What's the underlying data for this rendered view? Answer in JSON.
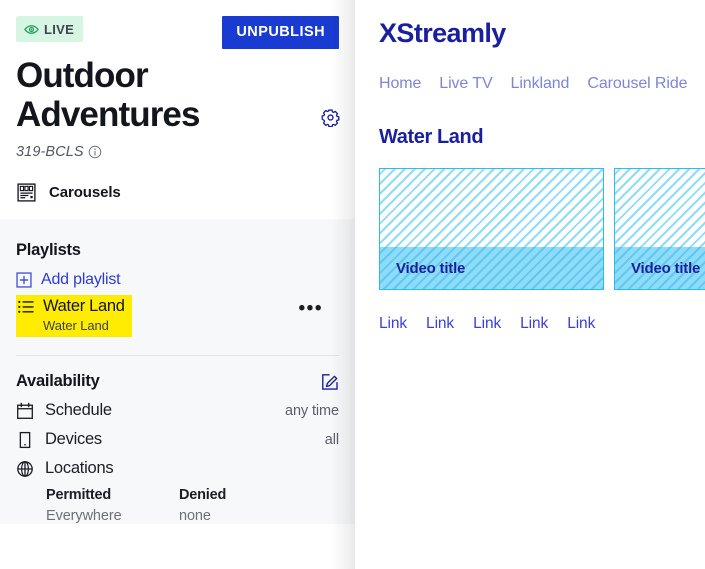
{
  "left": {
    "status_badge": {
      "icon": "eye-icon",
      "label": "LIVE"
    },
    "unpublish_label": "UNPUBLISH",
    "title": "Outdoor Adventures",
    "gear_icon": "gear-icon",
    "short_id": "319-BCLS",
    "info_icon": "info-icon",
    "carousels": {
      "icon": "carousels-icon",
      "label": "Carousels"
    },
    "playlists": {
      "section_title": "Playlists",
      "add_label": "Add playlist",
      "add_icon": "plus-square-icon",
      "items": [
        {
          "icon": "list-icon",
          "name": "Water Land",
          "subtitle": "Water Land",
          "menu": "•••"
        }
      ]
    },
    "availability": {
      "section_title": "Availability",
      "edit_icon": "edit-square-icon",
      "rows": [
        {
          "icon": "calendar-icon",
          "label": "Schedule",
          "value": "any time"
        },
        {
          "icon": "device-icon",
          "label": "Devices",
          "value": "all"
        },
        {
          "icon": "globe-icon",
          "label": "Locations",
          "value": ""
        }
      ],
      "locations": {
        "permitted_header": "Permitted",
        "denied_header": "Denied",
        "permitted_value": "Everywhere",
        "denied_value": "none"
      }
    }
  },
  "right": {
    "brand": "XStreamly",
    "nav": [
      {
        "label": "Home"
      },
      {
        "label": "Live TV"
      },
      {
        "label": "Linkland"
      },
      {
        "label": "Carousel Ride"
      }
    ],
    "carousel_title": "Water Land",
    "cards": [
      {
        "title": "Video title"
      },
      {
        "title": "Video title"
      }
    ],
    "links": [
      {
        "label": "Link"
      },
      {
        "label": "Link"
      },
      {
        "label": "Link"
      },
      {
        "label": "Link"
      },
      {
        "label": "Link"
      }
    ]
  },
  "colors": {
    "accent_blue": "#1a3bd1",
    "brand_navy": "#1a1f9e",
    "highlight_yellow": "#ffec00",
    "live_green_bg": "#d6f5e3",
    "live_green_fg": "#1e7d4f",
    "card_cyan": "#29bdf5",
    "panel_grey": "#f7f8f9"
  }
}
